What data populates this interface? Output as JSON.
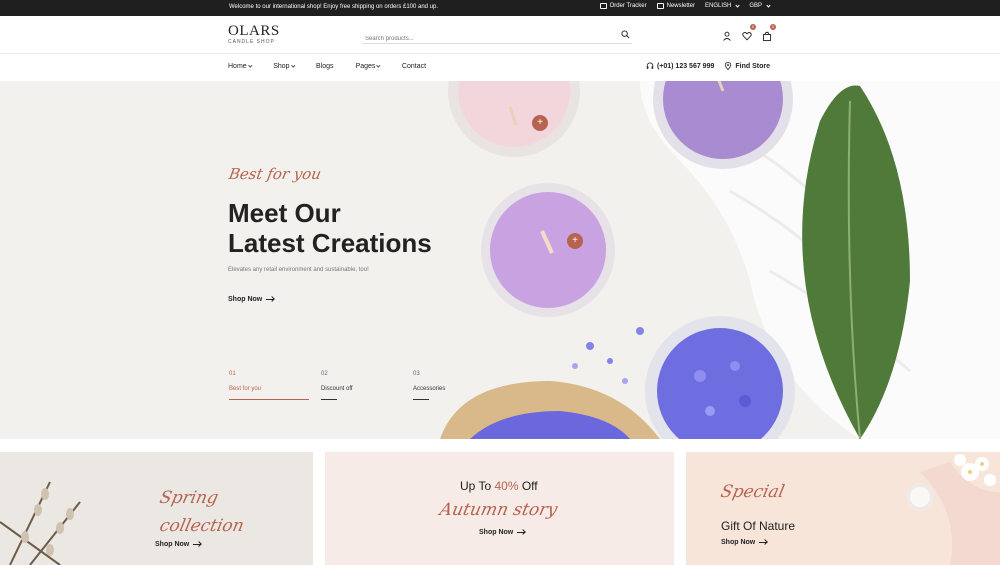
{
  "topbar": {
    "welcome": "Welcome to our international shop! Enjoy free shipping on orders £100 and up.",
    "order_tracker": "Order Tracker",
    "newsletter": "Newsletter",
    "language": "ENGLISH",
    "currency": "GBP"
  },
  "header": {
    "brand": "OLARS",
    "brand_sub": "CANDLE SHOP",
    "search_placeholder": "Search products...",
    "wishlist_count": "0",
    "cart_count": "0"
  },
  "nav": {
    "items": [
      "Home",
      "Shop",
      "Blogs",
      "Pages",
      "Contact"
    ],
    "phone": "(+01) 123 567 999",
    "find_store": "Find Store"
  },
  "hero": {
    "tagline": "Best for you",
    "title_line1": "Meet Our",
    "title_line2": "Latest Creations",
    "description": "Elevates any retail environment and sustainable, too!",
    "cta": "Shop Now",
    "steps": [
      {
        "num": "01",
        "label": "Best for you"
      },
      {
        "num": "02",
        "label": "Discount off"
      },
      {
        "num": "03",
        "label": "Accessories"
      }
    ]
  },
  "banners": [
    {
      "script1": "Spring",
      "script2": "collection",
      "cta": "Shop Now"
    },
    {
      "head_pre": "Up To ",
      "head_accent": "40%",
      "head_post": " Off",
      "script": "Autumn story",
      "cta": "Shop Now"
    },
    {
      "script": "Special",
      "head": "Gift Of Nature",
      "cta": "Shop Now"
    }
  ],
  "colors": {
    "accent": "#b8634f",
    "dark": "#1f1f1f",
    "hero_bg": "#f3f1ee"
  }
}
